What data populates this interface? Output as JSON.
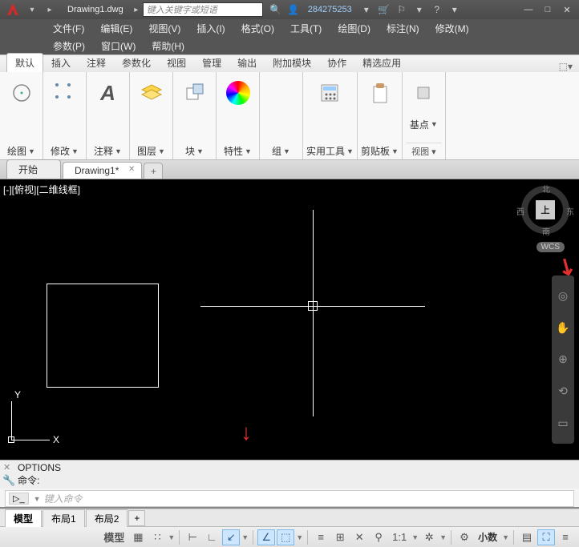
{
  "title": {
    "doc": "Drawing1.dwg",
    "search_placeholder": "键入关键字或短语",
    "user": "284275253"
  },
  "menus1": [
    "文件(F)",
    "编辑(E)",
    "视图(V)",
    "插入(I)",
    "格式(O)",
    "工具(T)",
    "绘图(D)",
    "标注(N)",
    "修改(M)"
  ],
  "menus2": [
    "参数(P)",
    "窗口(W)",
    "帮助(H)"
  ],
  "ribbon_tabs": [
    "默认",
    "插入",
    "注释",
    "参数化",
    "视图",
    "管理",
    "输出",
    "附加模块",
    "协作",
    "精选应用"
  ],
  "panels": [
    {
      "label": "绘图",
      "icon": "circle"
    },
    {
      "label": "修改",
      "icon": "dots"
    },
    {
      "label": "注释",
      "icon": "A"
    },
    {
      "label": "图层",
      "icon": "layers"
    },
    {
      "label": "块",
      "icon": "block"
    },
    {
      "label": "特性",
      "icon": "wheel"
    },
    {
      "label": "组",
      "icon": ""
    },
    {
      "label": "实用工具",
      "icon": "calc"
    },
    {
      "label": "剪贴板",
      "icon": "clip"
    },
    {
      "label": "基点",
      "icon": "base",
      "sub": "视图"
    }
  ],
  "file_tabs": {
    "start": "开始",
    "drawing": "Drawing1*"
  },
  "canvas": {
    "view_label": "[-][俯视][二维线框]",
    "viewcube": {
      "top": "上",
      "n": "北",
      "s": "南",
      "e": "东",
      "w": "西"
    },
    "wcs": "WCS",
    "ucs": {
      "x": "X",
      "y": "Y"
    }
  },
  "cmd": {
    "hist1": "OPTIONS",
    "hist2": "命令:",
    "placeholder": "键入命令"
  },
  "layout_tabs": [
    "模型",
    "布局1",
    "布局2"
  ],
  "status": {
    "model": "模型",
    "scale": "1:1",
    "units": "小数"
  }
}
